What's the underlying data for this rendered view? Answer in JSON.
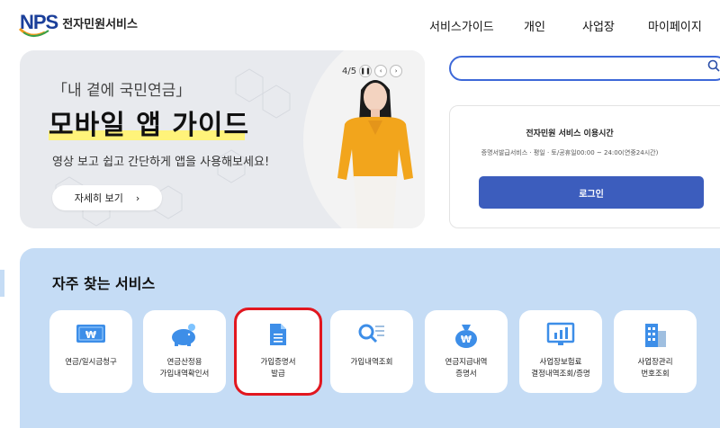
{
  "header": {
    "logo_mark": "NPS",
    "logo_text": "전자민원서비스",
    "nav": [
      {
        "label": "서비스가이드"
      },
      {
        "label": "개인"
      },
      {
        "label": "사업장"
      },
      {
        "label": "마이페이지"
      }
    ]
  },
  "banner": {
    "subtitle": "「내 곁에 국민연금」",
    "title": "모바일 앱 가이드",
    "description": "영상 보고 쉽고 간단하게 앱을 사용해보세요!",
    "button_label": "자세히 보기",
    "pager": "4/5"
  },
  "search": {
    "placeholder": ""
  },
  "service_hours": {
    "title": "전자민원 서비스 이용시간",
    "hours": "증명서발급서비스 · 평일 · 토/공휴일00:00 ~ 24:00(연중24시간)",
    "login_label": "로그인"
  },
  "favorites": {
    "title": "자주 찾는 서비스",
    "items": [
      {
        "label1": "연금/일시금청구",
        "label2": "",
        "icon": "won-bill-icon"
      },
      {
        "label1": "연금산정용",
        "label2": "가입내역확인서",
        "icon": "piggy-bank-icon"
      },
      {
        "label1": "가입증명서",
        "label2": "발급",
        "icon": "document-icon"
      },
      {
        "label1": "가입내역조회",
        "label2": "",
        "icon": "search-list-icon"
      },
      {
        "label1": "연금지급내역",
        "label2": "증명서",
        "icon": "money-bag-icon"
      },
      {
        "label1": "사업장보험료",
        "label2": "결정내역조회/증명",
        "icon": "monitor-chart-icon"
      },
      {
        "label1": "사업장관리",
        "label2": "번호조회",
        "icon": "building-icon"
      }
    ]
  },
  "colors": {
    "brand": "#1b3f9a",
    "accent": "#3c5dbd",
    "favorite_bg": "#c5dcf5",
    "highlight": "#fff37a",
    "selection": "#e2171f"
  }
}
